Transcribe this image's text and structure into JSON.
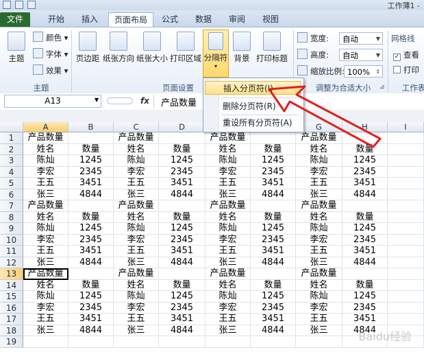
{
  "app": {
    "title": "工作薄1 -"
  },
  "tabs": [
    "文件",
    "开始",
    "插入",
    "页面布局",
    "公式",
    "数据",
    "审阅",
    "视图"
  ],
  "ribbon": {
    "theme_group": {
      "label": "主题",
      "themes_btn": "主题",
      "colors": "颜色",
      "fonts": "字体",
      "effects": "效果"
    },
    "page_setup": {
      "label": "页面设置",
      "margins": "页边距",
      "orientation": "纸张方向",
      "size": "纸张大小",
      "print_area": "打印区域",
      "breaks": "分隔符",
      "background": "背景",
      "print_titles": "打印标题"
    },
    "scale": {
      "label": "调整为合适大小",
      "width_label": "宽度:",
      "width_val": "自动",
      "height_label": "高度:",
      "height_val": "自动",
      "scale_label": "缩放比例:",
      "scale_val": "100%"
    },
    "sheet_opts": {
      "gridlines": "网格线",
      "view": "查看",
      "print": "打印",
      "label": "工作表"
    }
  },
  "breaks_menu": {
    "insert": "插入分页符(I)",
    "remove": "删除分页符(R)",
    "reset": "重设所有分页符(A)"
  },
  "formula_bar": {
    "name_box": "A13",
    "fx": "fx",
    "content": "产品数量"
  },
  "columns": [
    "A",
    "B",
    "C",
    "D",
    "E",
    "F",
    "G",
    "H",
    "I"
  ],
  "rows": [
    [
      "1",
      "产品数量",
      "",
      "产品数量",
      "",
      "产品数量",
      "",
      "产品数量",
      ""
    ],
    [
      "2",
      "姓名",
      "数量",
      "姓名",
      "数量",
      "姓名",
      "数量",
      "姓名",
      "数量"
    ],
    [
      "3",
      "陈灿",
      "1245",
      "陈灿",
      "1245",
      "陈灿",
      "1245",
      "陈灿",
      "1245"
    ],
    [
      "4",
      "李宏",
      "2345",
      "李宏",
      "2345",
      "李宏",
      "2345",
      "李宏",
      "2345"
    ],
    [
      "5",
      "王五",
      "3451",
      "王五",
      "3451",
      "王五",
      "3451",
      "王五",
      "3451"
    ],
    [
      "6",
      "张三",
      "4844",
      "张三",
      "4844",
      "张三",
      "4844",
      "张三",
      "4844"
    ],
    [
      "7",
      "产品数量",
      "",
      "产品数量",
      "",
      "产品数量",
      "",
      "产品数量",
      ""
    ],
    [
      "8",
      "姓名",
      "数量",
      "姓名",
      "数量",
      "姓名",
      "数量",
      "姓名",
      "数量"
    ],
    [
      "9",
      "陈灿",
      "1245",
      "陈灿",
      "1245",
      "陈灿",
      "1245",
      "陈灿",
      "1245"
    ],
    [
      "10",
      "李宏",
      "2345",
      "李宏",
      "2345",
      "李宏",
      "2345",
      "李宏",
      "2345"
    ],
    [
      "11",
      "王五",
      "3451",
      "王五",
      "3451",
      "王五",
      "3451",
      "王五",
      "3451"
    ],
    [
      "12",
      "张三",
      "4844",
      "张三",
      "4844",
      "张三",
      "4844",
      "张三",
      "4844"
    ],
    [
      "13",
      "产品数量",
      "",
      "产品数量",
      "",
      "产品数量",
      "",
      "产品数量",
      ""
    ],
    [
      "14",
      "姓名",
      "数量",
      "姓名",
      "数量",
      "姓名",
      "数量",
      "姓名",
      "数量"
    ],
    [
      "15",
      "陈灿",
      "1245",
      "陈灿",
      "1245",
      "陈灿",
      "1245",
      "陈灿",
      "1245"
    ],
    [
      "16",
      "李宏",
      "2345",
      "李宏",
      "2345",
      "李宏",
      "2345",
      "李宏",
      "2345"
    ],
    [
      "17",
      "王五",
      "3451",
      "王五",
      "3451",
      "王五",
      "3451",
      "王五",
      "3451"
    ],
    [
      "18",
      "张三",
      "4844",
      "张三",
      "4844",
      "张三",
      "4844",
      "张三",
      "4844"
    ],
    [
      "19",
      "",
      "",
      "",
      "",
      "",
      "",
      "",
      ""
    ]
  ],
  "watermark": "Baidu经验",
  "colors": {
    "file_tab": "#2a6a2f",
    "highlight": "#ffe08c",
    "arrow": "#e0201e"
  }
}
